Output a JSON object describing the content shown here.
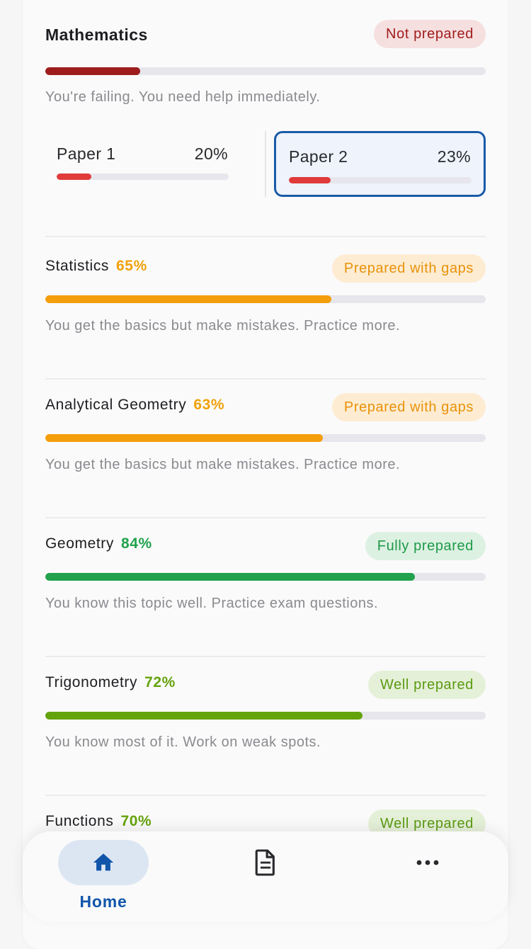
{
  "colors": {
    "red": "#e03a3a",
    "dark_red": "#9e1c1c",
    "orange": "#f59e0b",
    "green": "#22a24c",
    "lime": "#65a30d",
    "blue": "#1155aa"
  },
  "mathematics": {
    "title": "Mathematics",
    "badge": "Not prepared",
    "progress": 0.215,
    "description": "You're failing. You need help immediately.",
    "papers": [
      {
        "name": "Paper 1",
        "percent": "20%",
        "progress": 0.2,
        "selected": false
      },
      {
        "name": "Paper 2",
        "percent": "23%",
        "progress": 0.23,
        "selected": true
      }
    ]
  },
  "topics": [
    {
      "name": "Statistics",
      "percent": "65%",
      "progress": 0.65,
      "badge": "Prepared with gaps",
      "description": "You get the basics but make mistakes. Practice more.",
      "tone": "orange"
    },
    {
      "name": "Analytical Geometry",
      "percent": "63%",
      "progress": 0.63,
      "badge": "Prepared with gaps",
      "description": "You get the basics but make mistakes. Practice more.",
      "tone": "orange"
    },
    {
      "name": "Geometry",
      "percent": "84%",
      "progress": 0.84,
      "badge": "Fully prepared",
      "description": "You know this topic well. Practice exam questions.",
      "tone": "green"
    },
    {
      "name": "Trigonometry",
      "percent": "72%",
      "progress": 0.72,
      "badge": "Well prepared",
      "description": "You know most of it. Work on weak spots.",
      "tone": "lime"
    },
    {
      "name": "Functions",
      "percent": "70%",
      "progress": 0.7,
      "badge": "Well prepared",
      "description": "",
      "tone": "lime"
    }
  ],
  "nav": {
    "items": [
      {
        "label": "Home",
        "icon": "home-icon",
        "active": true
      },
      {
        "label": "",
        "icon": "document-icon",
        "active": false
      },
      {
        "label": "",
        "icon": "more-icon",
        "active": false
      }
    ]
  }
}
